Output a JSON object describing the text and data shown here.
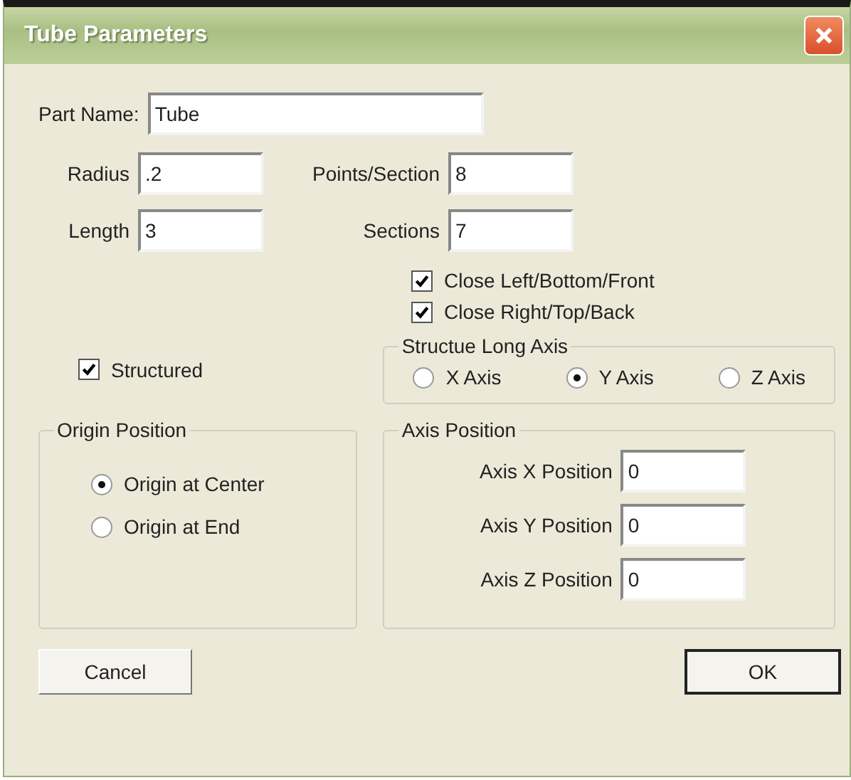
{
  "window": {
    "title": "Tube Parameters"
  },
  "part_name": {
    "label": "Part Name:",
    "value": "Tube"
  },
  "left_fields": [
    {
      "label": "Radius",
      "value": ".2"
    },
    {
      "label": "Length",
      "value": "3"
    }
  ],
  "right_fields": [
    {
      "label": "Points/Section",
      "value": "8"
    },
    {
      "label": "Sections",
      "value": "7"
    }
  ],
  "close_options": [
    {
      "label": "Close Left/Bottom/Front",
      "checked": true
    },
    {
      "label": "Close Right/Top/Back",
      "checked": true
    }
  ],
  "structured": {
    "label": "Structured",
    "checked": true
  },
  "long_axis": {
    "title": "Structue Long Axis",
    "options": [
      {
        "label": "X Axis",
        "selected": false
      },
      {
        "label": "Y Axis",
        "selected": true
      },
      {
        "label": "Z Axis",
        "selected": false
      }
    ]
  },
  "origin_position": {
    "title": "Origin Position",
    "options": [
      {
        "label": "Origin at Center",
        "selected": true
      },
      {
        "label": "Origin at End",
        "selected": false
      }
    ]
  },
  "axis_position": {
    "title": "Axis Position",
    "fields": [
      {
        "label": "Axis X Position",
        "value": "0"
      },
      {
        "label": "Axis Y Position",
        "value": "0"
      },
      {
        "label": "Axis Z Position",
        "value": "0"
      }
    ]
  },
  "buttons": [
    {
      "label": "Cancel",
      "default": false
    },
    {
      "label": "OK",
      "default": true
    }
  ]
}
